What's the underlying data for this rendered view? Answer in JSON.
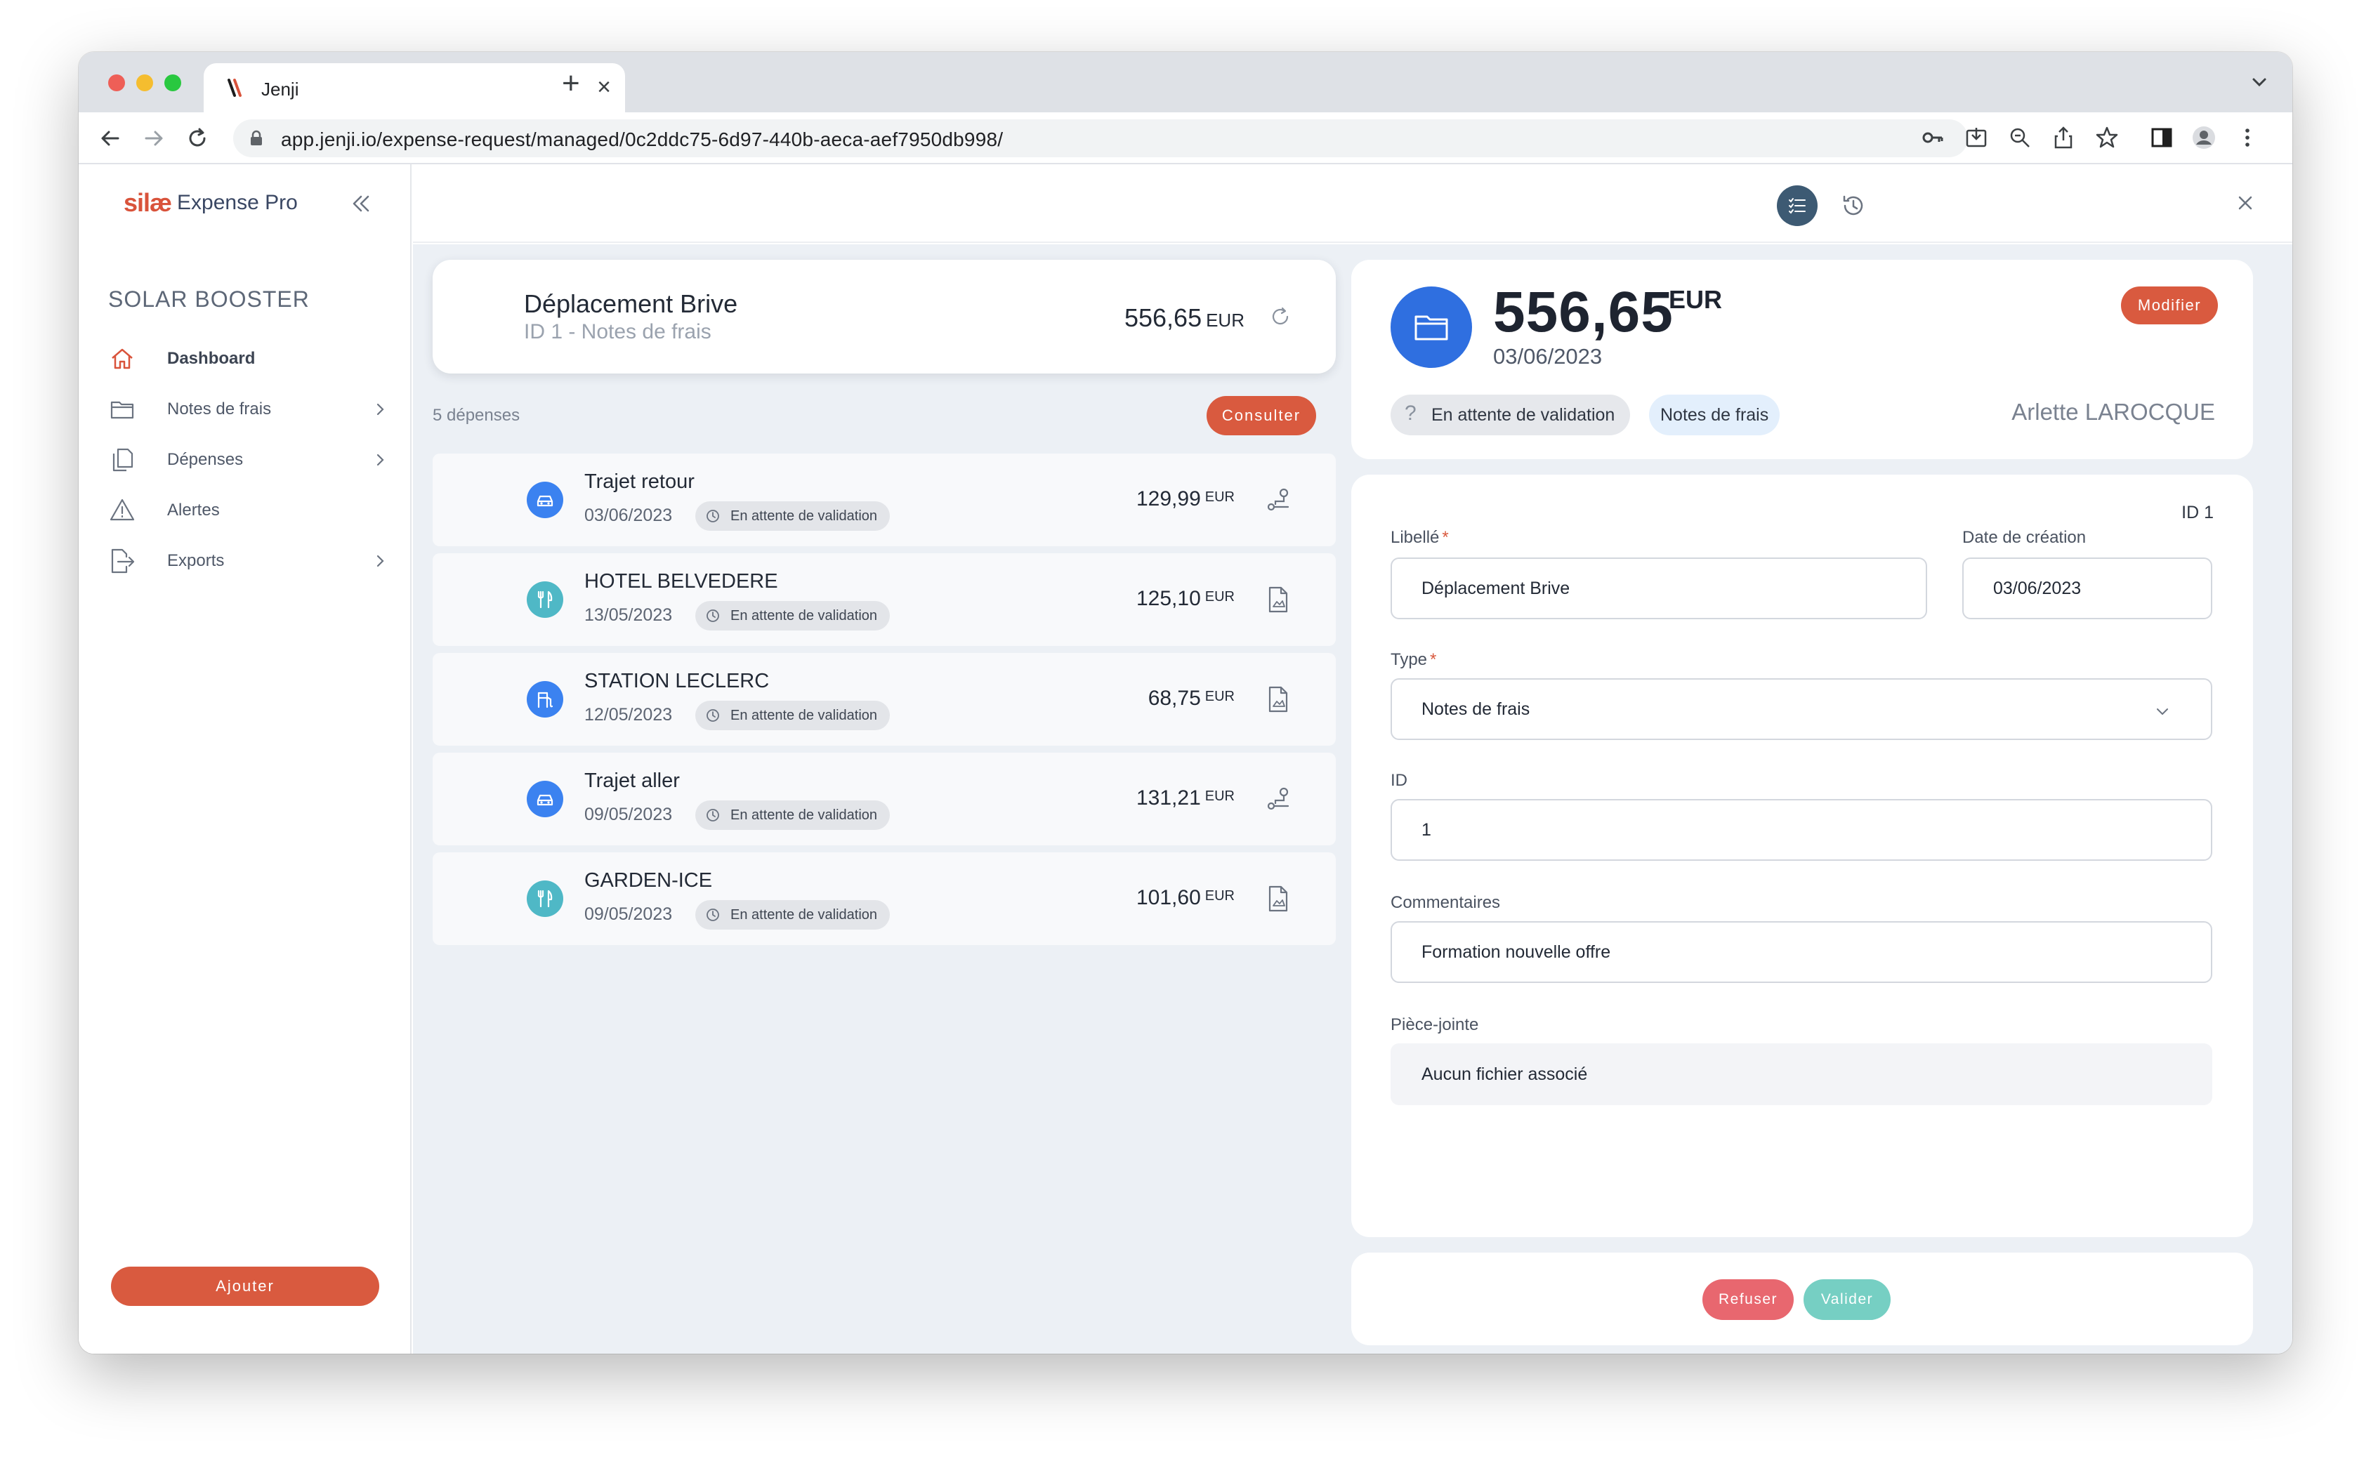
{
  "browser": {
    "tab_title": "Jenji",
    "url": "app.jenji.io/expense-request/managed/0c2ddc75-6d97-440b-aeca-aef7950db998/"
  },
  "sidebar": {
    "logo_brand": "silæ",
    "logo_product": "Expense Pro",
    "company": "SOLAR BOOSTER",
    "items": [
      {
        "label": "Dashboard",
        "icon": "home-icon",
        "active": true,
        "has_submenu": false
      },
      {
        "label": "Notes de frais",
        "icon": "folder-icon",
        "active": false,
        "has_submenu": true
      },
      {
        "label": "Dépenses",
        "icon": "documents-icon",
        "active": false,
        "has_submenu": true
      },
      {
        "label": "Alertes",
        "icon": "warning-icon",
        "active": false,
        "has_submenu": false
      },
      {
        "label": "Exports",
        "icon": "export-icon",
        "active": false,
        "has_submenu": true
      }
    ],
    "add_label": "Ajouter"
  },
  "report": {
    "title": "Déplacement Brive",
    "subtitle": "ID 1 - Notes de frais",
    "amount": "556,65",
    "currency": "EUR",
    "expenses_count": "5 dépenses",
    "consult_label": "Consulter"
  },
  "expenses": [
    {
      "title": "Trajet retour",
      "date": "03/06/2023",
      "status": "En attente de validation",
      "amount": "129,99",
      "currency": "EUR",
      "icon": "car-icon",
      "action_icon": "route-icon"
    },
    {
      "title": "HOTEL BELVEDERE",
      "date": "13/05/2023",
      "status": "En attente de validation",
      "amount": "125,10",
      "currency": "EUR",
      "icon": "restaurant-icon",
      "action_icon": "receipt-icon"
    },
    {
      "title": "STATION LECLERC",
      "date": "12/05/2023",
      "status": "En attente de validation",
      "amount": "68,75",
      "currency": "EUR",
      "icon": "fuel-icon",
      "action_icon": "receipt-icon"
    },
    {
      "title": "Trajet aller",
      "date": "09/05/2023",
      "status": "En attente de validation",
      "amount": "131,21",
      "currency": "EUR",
      "icon": "car-icon",
      "action_icon": "route-icon"
    },
    {
      "title": "GARDEN-ICE",
      "date": "09/05/2023",
      "status": "En attente de validation",
      "amount": "101,60",
      "currency": "EUR",
      "icon": "restaurant-icon",
      "action_icon": "receipt-icon"
    }
  ],
  "detail": {
    "amount": "556,65",
    "currency": "EUR",
    "date": "03/06/2023",
    "modify_label": "Modifier",
    "status": "En attente de validation",
    "type_tag": "Notes de frais",
    "owner": "Arlette LAROCQUE"
  },
  "form": {
    "id_label": "ID 1",
    "libelle_label": "Libellé",
    "libelle_value": "Déplacement Brive",
    "date_label": "Date de création",
    "date_value": "03/06/2023",
    "type_label": "Type",
    "type_value": "Notes de frais",
    "id_field_label": "ID",
    "id_value": "1",
    "comments_label": "Commentaires",
    "comments_value": "Formation nouvelle offre",
    "attachment_label": "Pièce-jointe",
    "attachment_value": "Aucun fichier associé",
    "required_mark": "*"
  },
  "actions": {
    "refuse_label": "Refuser",
    "validate_label": "Valider"
  },
  "colors": {
    "accent": "#d95a3f",
    "primary_blue": "#2f6fe0",
    "refuse": "#e8676f",
    "validate": "#76cfc3",
    "background": "#ecf0f5"
  }
}
